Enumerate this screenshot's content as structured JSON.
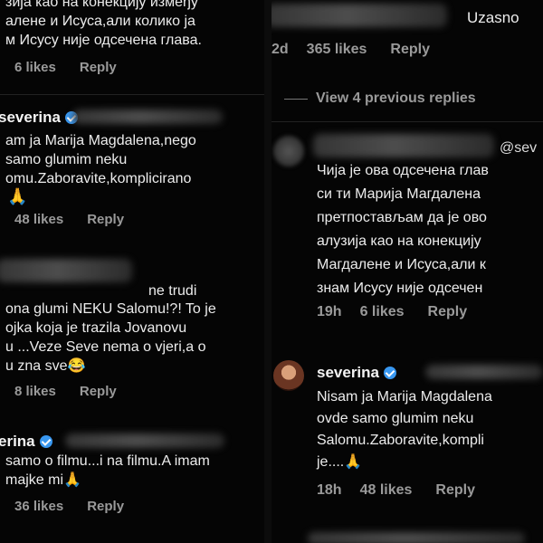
{
  "left": {
    "c1": {
      "lines": [
        "зија као на конекцију између",
        "алене и Исуса,али колико ја",
        "м Исусу није одсечена глава."
      ],
      "likes": "6 likes",
      "reply": "Reply"
    },
    "c2": {
      "user": "severina",
      "lines": [
        "am ja Marija Magdalena,nego",
        "samo glumim neku",
        "omu.Zaboravite,komplicirano",
        "🙏"
      ],
      "likes": "48 likes",
      "reply": "Reply"
    },
    "c3": {
      "lines": [
        "ne trudi",
        "ona glumi NEKU Salomu!?! To je",
        "ojka koja je trazila Jovanovu",
        "u ...Veze Seve nema o vjeri,a o",
        "u zna sve😂"
      ],
      "likes": "8 likes",
      "reply": "Reply"
    },
    "c4": {
      "user": "erina",
      "lines": [
        "samo o filmu...i na filmu.A imam",
        "majke mi🙏"
      ],
      "likes": "36 likes",
      "reply": "Reply"
    }
  },
  "right": {
    "c1": {
      "text": "Uzasno",
      "time": "2d",
      "likes": "365 likes",
      "reply": "Reply"
    },
    "view_replies": "View 4 previous replies",
    "c2": {
      "mention": "@sev",
      "lines": [
        "Чија је ова одсечена глав",
        "си ти Марија Магдалена",
        "претпостављам да је ово",
        "алузија као на конекцију",
        "Магдалене и Исуса,али к",
        "знам Исусу није одсечен"
      ],
      "time": "19h",
      "likes": "6 likes",
      "reply": "Reply"
    },
    "c3": {
      "user": "severina",
      "lines": [
        "Nisam ja Marija Magdalena",
        "ovde samo glumim neku",
        "Salomu.Zaboravite,kompli",
        "je....🙏"
      ],
      "time": "18h",
      "likes": "48 likes",
      "reply": "Reply"
    }
  },
  "colors": {
    "background": "#000000",
    "verified": "#3897f0",
    "meta": "#9a9a9a"
  }
}
